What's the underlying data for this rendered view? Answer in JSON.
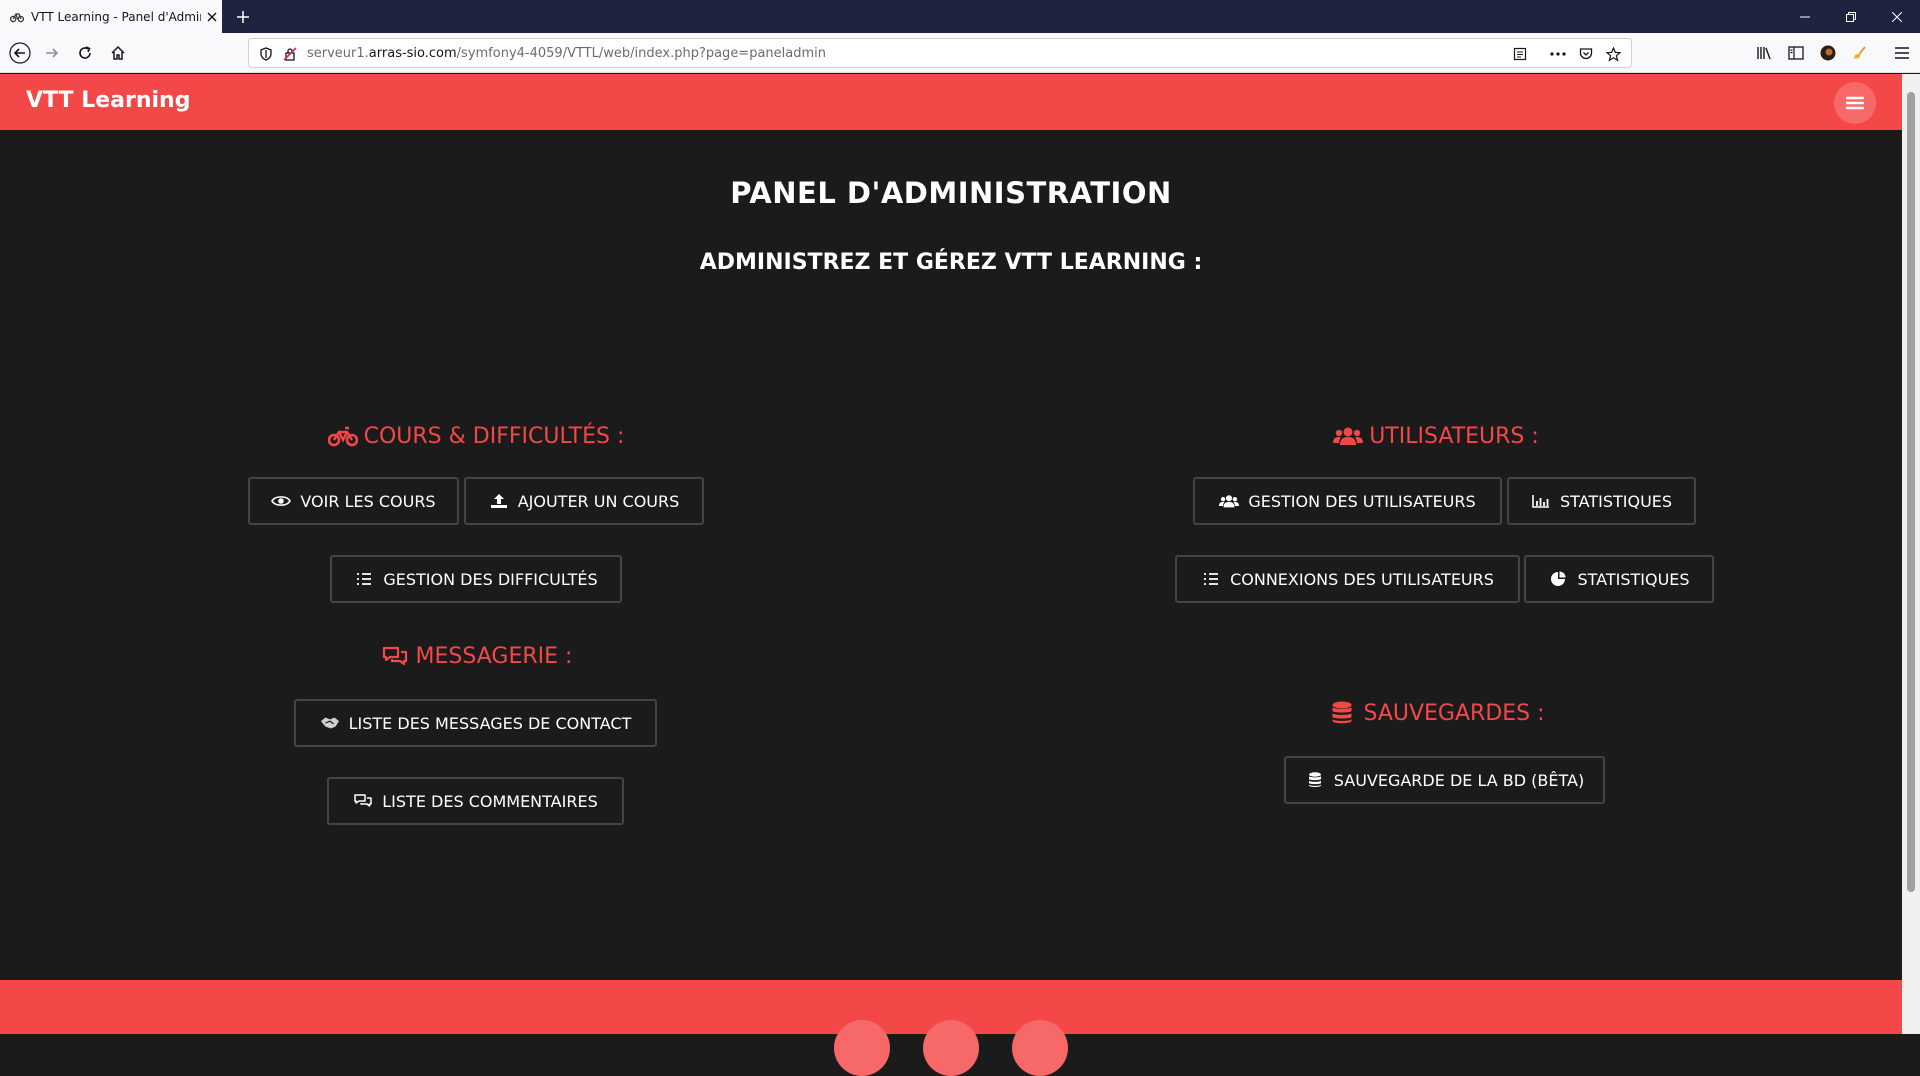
{
  "browser": {
    "tab_title": "VTT Learning - Panel d'Administration",
    "url_prefix": "serveur1.",
    "url_host": "arras-sio.com",
    "url_path": "/symfony4-4059/VTTL/web/index.php?page=paneladmin"
  },
  "site": {
    "brand": "VTT Learning"
  },
  "page": {
    "title": "PANEL D'ADMINISTRATION",
    "subtitle": "ADMINISTREZ ET GÉREZ VTT LEARNING :"
  },
  "sections": {
    "cours": {
      "title": "COURS & DIFFICULTÉS :",
      "icon": "bicycle-icon",
      "buttons": {
        "voir": "VOIR LES COURS",
        "ajouter": "AJOUTER UN COURS",
        "difficultes": "GESTION DES DIFFICULTÉS"
      }
    },
    "messagerie": {
      "title": "MESSAGERIE :",
      "icon": "comments-icon",
      "buttons": {
        "contact": "LISTE DES MESSAGES DE CONTACT",
        "commentaires": "LISTE DES COMMENTAIRES"
      }
    },
    "utilisateurs": {
      "title": "UTILISATEURS :",
      "icon": "users-icon",
      "buttons": {
        "gestion": "GESTION DES UTILISATEURS",
        "stats1": "STATISTIQUES",
        "connexions": "CONNEXIONS DES UTILISATEURS",
        "stats2": "STATISTIQUES"
      }
    },
    "sauvegardes": {
      "title": "SAUVEGARDES :",
      "icon": "database-icon",
      "buttons": {
        "bd": "SAUVEGARDE DE LA BD (BÊTA)"
      }
    }
  },
  "colors": {
    "accent": "#f44848",
    "background": "#1c1b1c",
    "button_border": "#444345"
  }
}
